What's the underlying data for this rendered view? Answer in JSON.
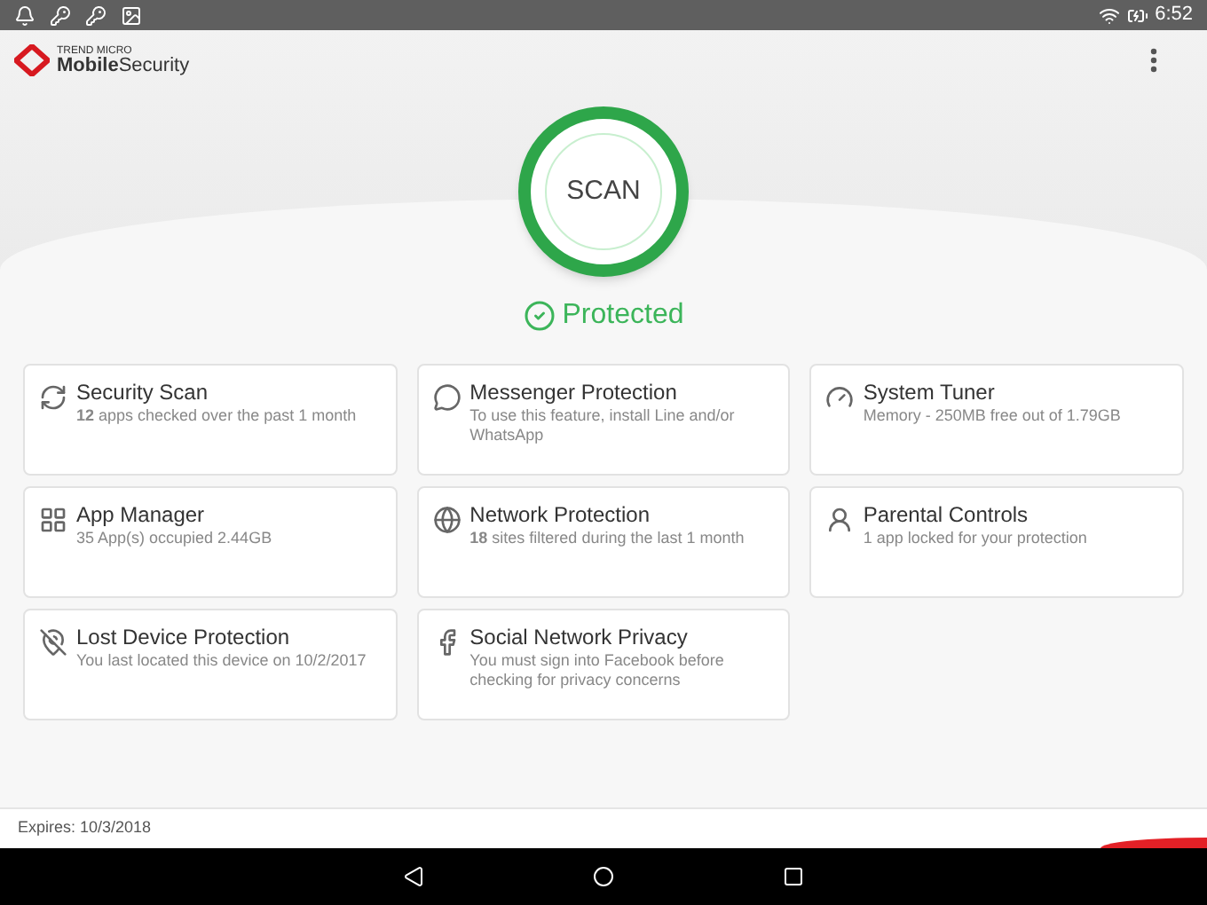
{
  "status_bar": {
    "time": "6:52"
  },
  "app_bar": {
    "brand_top": "TREND MICRO",
    "brand_bold": "Mobile",
    "brand_rest": "Security"
  },
  "scan": {
    "label": "SCAN",
    "status": "Protected"
  },
  "features": [
    {
      "kind": "scan",
      "title": "Security Scan",
      "detail": "**12** apps checked over the past 1 month"
    },
    {
      "kind": "messenger",
      "title": "Messenger Protection",
      "detail": "To use this feature, install Line and/or WhatsApp"
    },
    {
      "kind": "tuner",
      "title": "System Tuner",
      "detail": "Memory - 250MB free out of 1.79GB"
    },
    {
      "kind": "apps",
      "title": "App Manager",
      "detail": "35 App(s) occupied 2.44GB"
    },
    {
      "kind": "network",
      "title": "Network Protection",
      "detail": "**18** sites filtered during the last 1 month"
    },
    {
      "kind": "parental",
      "title": "Parental Controls",
      "detail": "1 app locked for your protection"
    },
    {
      "kind": "lost",
      "title": "Lost Device Protection",
      "detail": "You last located this device on 10/2/2017"
    },
    {
      "kind": "social",
      "title": "Social Network Privacy",
      "detail": "You must sign into Facebook before checking for privacy concerns"
    }
  ],
  "footer": {
    "expires": "Expires: 10/3/2018"
  }
}
